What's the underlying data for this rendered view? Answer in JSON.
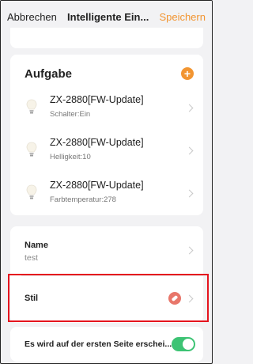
{
  "header": {
    "cancel_label": "Abbrechen",
    "title": "Intelligente Ein...",
    "save_label": "Speichern"
  },
  "aufgabe": {
    "title": "Aufgabe",
    "add_icon": "plus-icon",
    "tasks": [
      {
        "name": "ZX-2880[FW-Update]",
        "detail": "Schalter:Ein",
        "icon": "bulb-icon"
      },
      {
        "name": "ZX-2880[FW-Update]",
        "detail": "Helligkeit:10",
        "icon": "bulb-icon"
      },
      {
        "name": "ZX-2880[FW-Update]",
        "detail": "Farbtemperatur:278",
        "icon": "bulb-icon"
      }
    ]
  },
  "settings": {
    "name_label": "Name",
    "name_value": "test",
    "style_label": "Stil",
    "style_icon": "tag-icon",
    "style_color": "#e8766a",
    "first_page_label": "Es wird auf der ersten Seite erschei...",
    "first_page_enabled": true
  },
  "colors": {
    "accent": "#f29531",
    "toggle_on": "#3dc374",
    "highlight": "#e5141e"
  }
}
